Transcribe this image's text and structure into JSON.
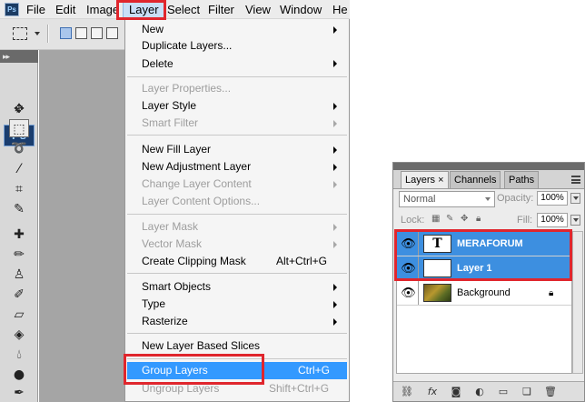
{
  "menubar": {
    "app_icon": "ps-icon",
    "items": [
      "File",
      "Edit",
      "Image",
      "Layer",
      "Select",
      "Filter",
      "View",
      "Window",
      "He"
    ]
  },
  "toolbox": {
    "logo": "Ps",
    "header": "▸▸"
  },
  "layer_menu": {
    "items": [
      {
        "label": "New",
        "submenu": true,
        "disabled": false
      },
      {
        "label": "Duplicate Layers...",
        "submenu": false,
        "disabled": false
      },
      {
        "label": "Delete",
        "submenu": true,
        "disabled": false
      },
      {
        "label": "Layer Properties...",
        "submenu": false,
        "disabled": true
      },
      {
        "label": "Layer Style",
        "submenu": true,
        "disabled": false
      },
      {
        "label": "Smart Filter",
        "submenu": true,
        "disabled": true
      },
      {
        "label": "New Fill Layer",
        "submenu": true,
        "disabled": false
      },
      {
        "label": "New Adjustment Layer",
        "submenu": true,
        "disabled": false
      },
      {
        "label": "Change Layer Content",
        "submenu": true,
        "disabled": true
      },
      {
        "label": "Layer Content Options...",
        "submenu": false,
        "disabled": true
      },
      {
        "label": "Layer Mask",
        "submenu": true,
        "disabled": true
      },
      {
        "label": "Vector Mask",
        "submenu": true,
        "disabled": true
      },
      {
        "label": "Create Clipping Mask",
        "shortcut": "Alt+Ctrl+G",
        "submenu": false,
        "disabled": false
      },
      {
        "label": "Smart Objects",
        "submenu": true,
        "disabled": false
      },
      {
        "label": "Type",
        "submenu": true,
        "disabled": false
      },
      {
        "label": "Rasterize",
        "submenu": true,
        "disabled": false
      },
      {
        "label": "New Layer Based Slices",
        "submenu": false,
        "disabled": false
      },
      {
        "label": "Group Layers",
        "shortcut": "Ctrl+G",
        "submenu": false,
        "disabled": false,
        "highlighted": true
      },
      {
        "label": "Ungroup Layers",
        "shortcut": "Shift+Ctrl+G",
        "submenu": false,
        "disabled": true
      }
    ]
  },
  "layers_panel": {
    "tabs": [
      "Layers",
      "Channels",
      "Paths"
    ],
    "active_tab": "Layers",
    "tab_close": "×",
    "blend_mode": "Normal",
    "opacity_label": "Opacity:",
    "opacity_value": "100%",
    "lock_label": "Lock:",
    "fill_label": "Fill:",
    "fill_value": "100%",
    "layers": [
      {
        "name": "MERAFORUM",
        "thumb_text": "T",
        "selected": true
      },
      {
        "name": "Layer 1",
        "thumb_text": "",
        "selected": true
      },
      {
        "name": "Background",
        "thumb_text": "",
        "selected": false,
        "locked": true
      }
    ]
  },
  "colors": {
    "highlight": "#3399ff",
    "selection_row": "#3d8fe0",
    "callout": "#e0262d"
  }
}
